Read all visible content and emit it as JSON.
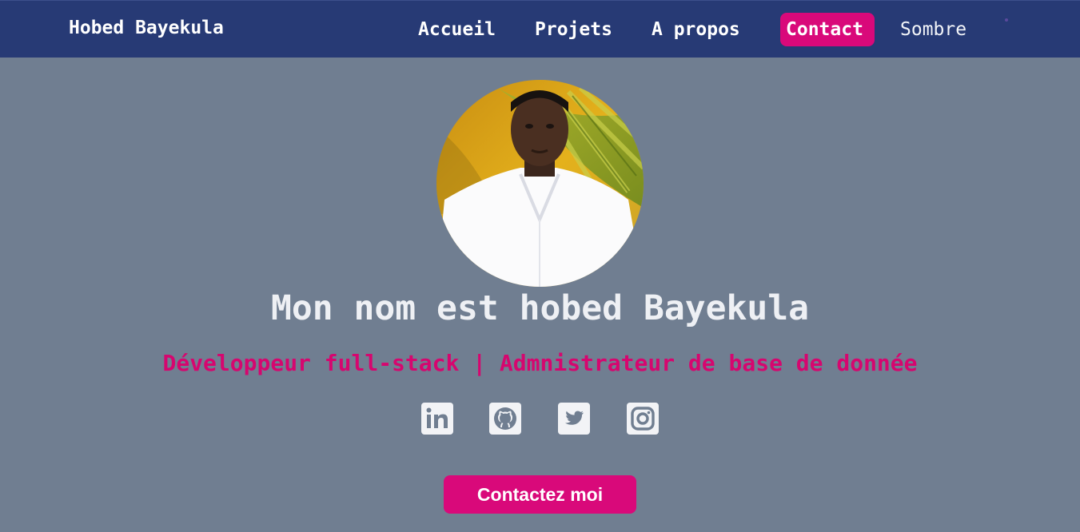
{
  "navbar": {
    "brand": "Hobed Bayekula",
    "links": [
      {
        "label": "Accueil",
        "active": false
      },
      {
        "label": "Projets",
        "active": false
      },
      {
        "label": "A propos",
        "active": false
      },
      {
        "label": "Contact",
        "active": true
      }
    ],
    "theme_toggle": "Sombre"
  },
  "hero": {
    "avatar_icon": "profile-photo",
    "title": "Mon nom est hobed Bayekula",
    "subtitle": "Développeur full-stack | Admnistrateur de base de donnée",
    "socials": [
      {
        "icon": "linkedin-icon"
      },
      {
        "icon": "github-icon"
      },
      {
        "icon": "twitter-icon"
      },
      {
        "icon": "instagram-icon"
      }
    ],
    "cta_label": "Contactez moi"
  },
  "colors": {
    "navbar_bg": "#273a75",
    "page_bg": "#707e91",
    "accent": "#d9097a",
    "subtitle": "#d6066f",
    "title": "#eef0f4"
  }
}
